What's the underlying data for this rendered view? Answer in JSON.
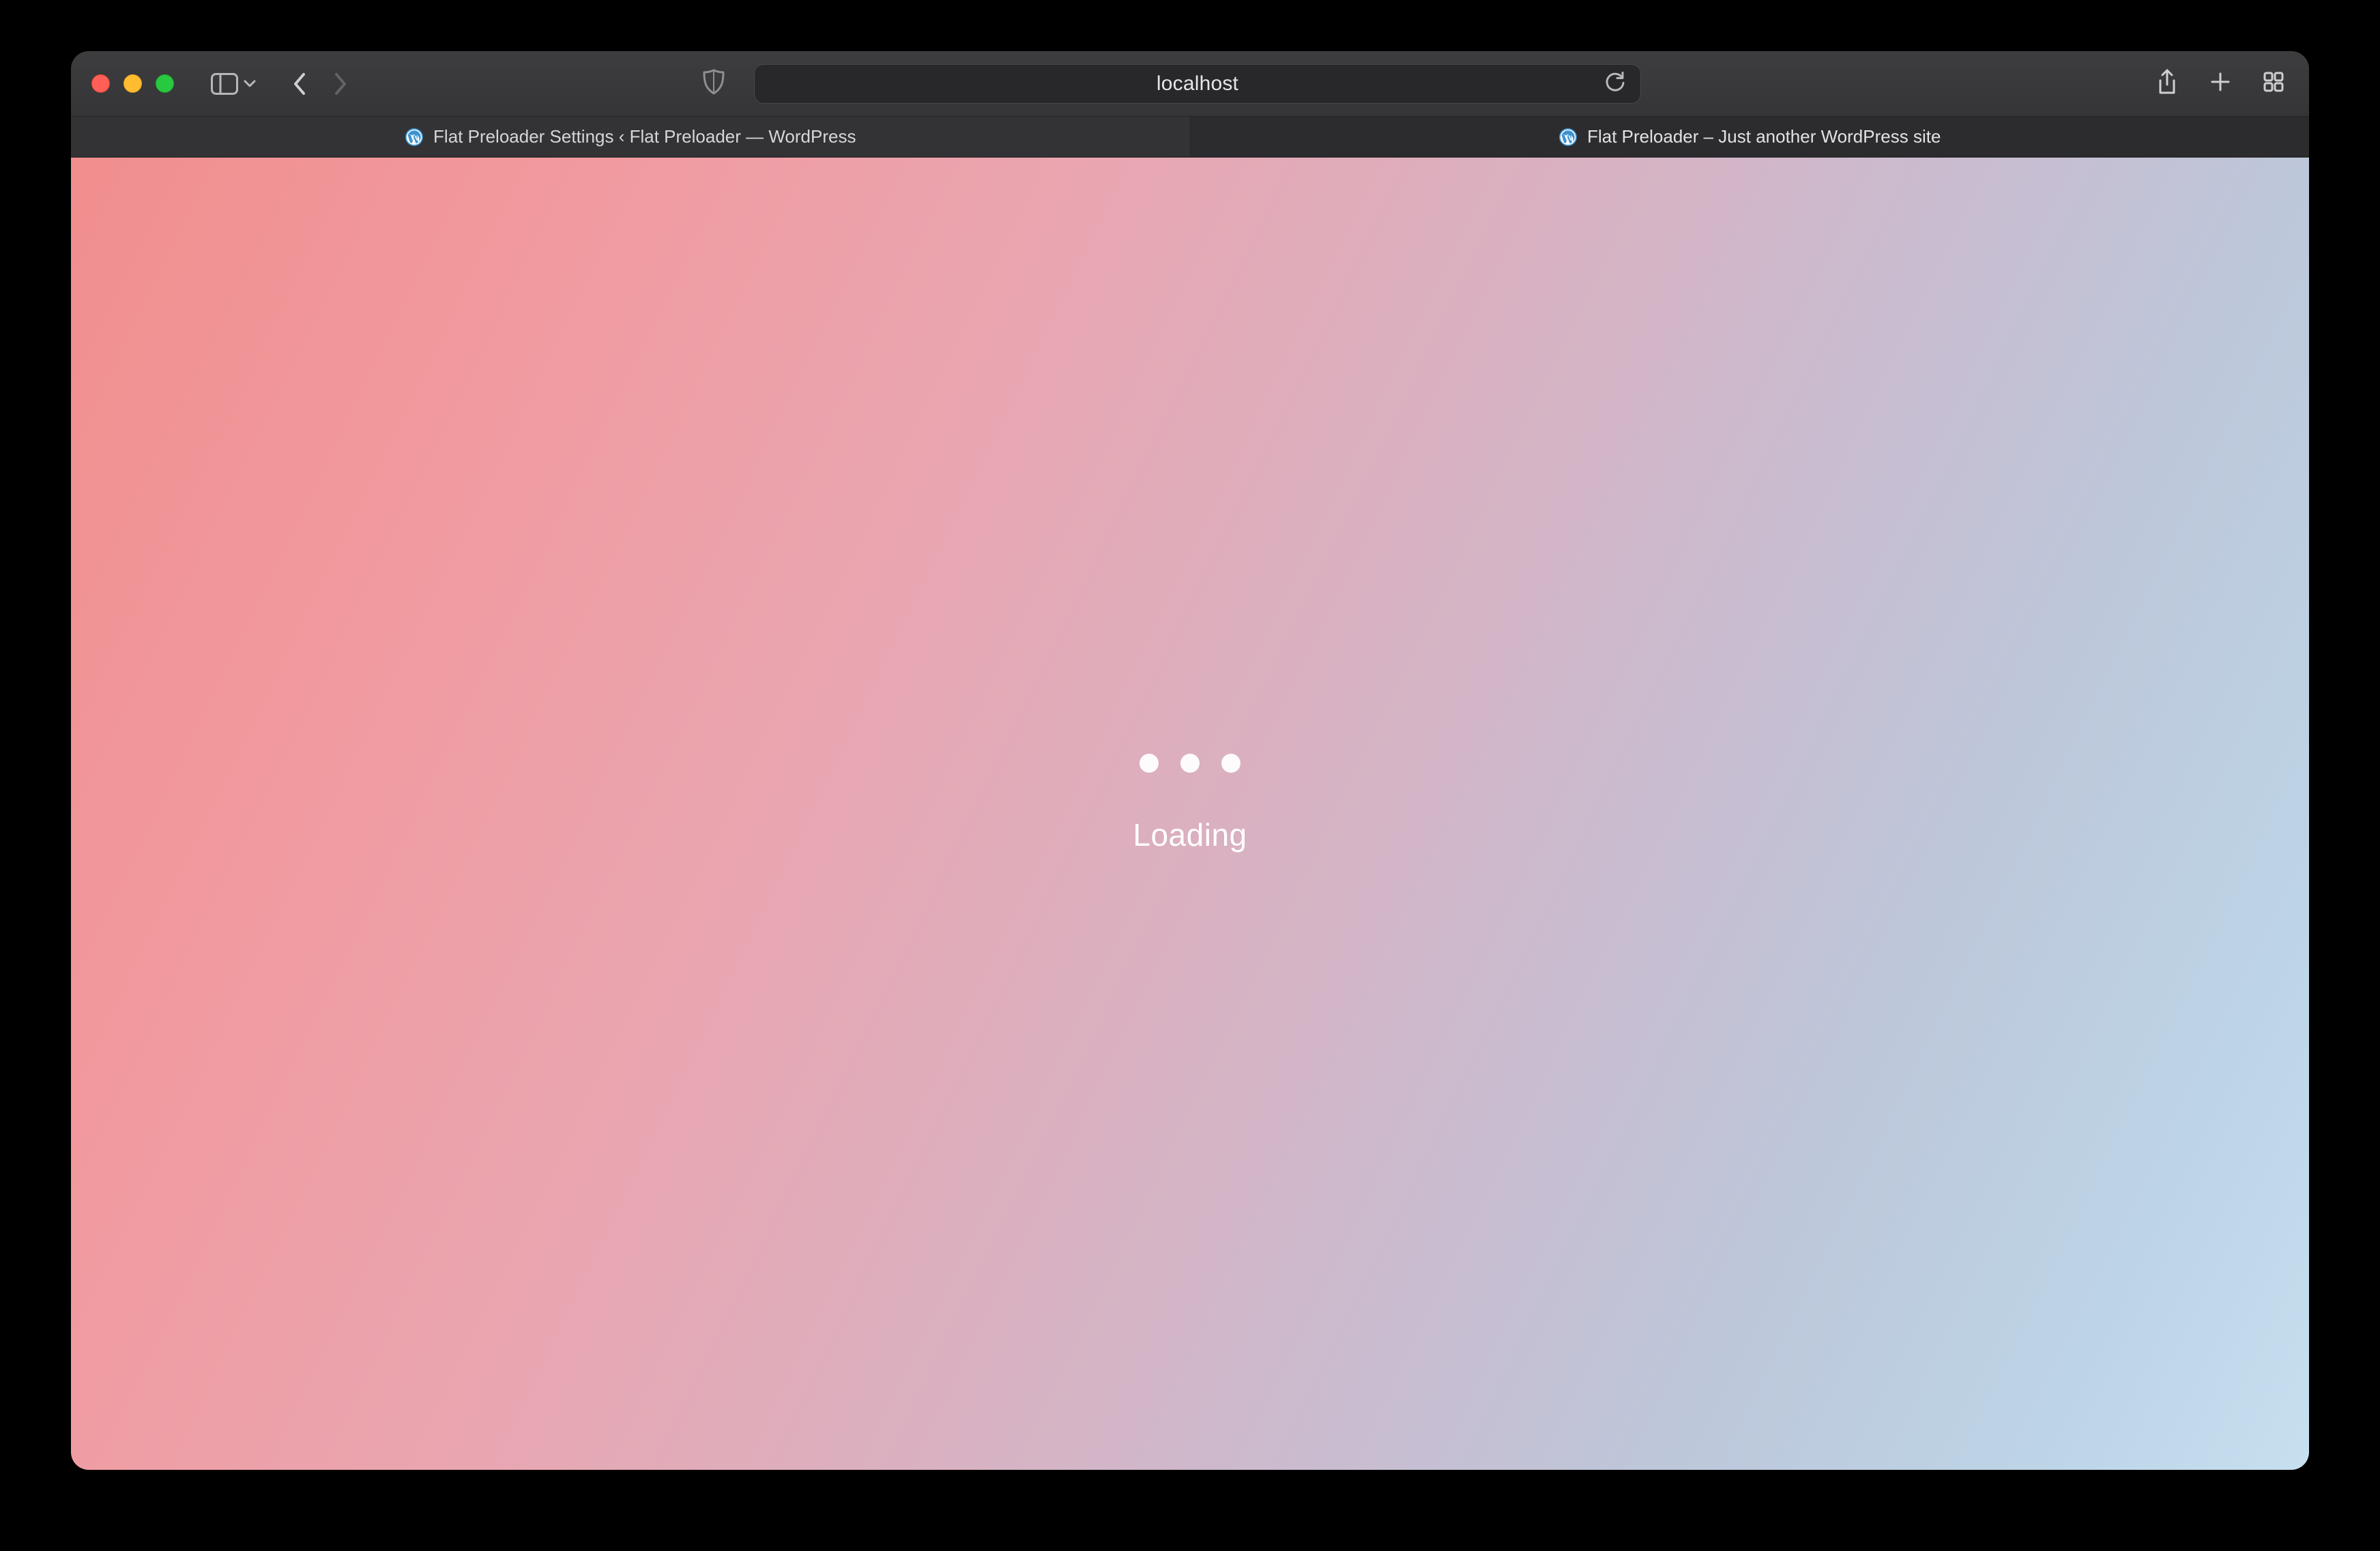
{
  "url_bar": {
    "host": "localhost"
  },
  "tabs": [
    {
      "title": "Flat Preloader Settings ‹ Flat Preloader — WordPress",
      "active": false,
      "icon": "wordpress"
    },
    {
      "title": "Flat Preloader – Just another WordPress site",
      "active": true,
      "icon": "wordpress"
    }
  ],
  "preloader": {
    "text": "Loading",
    "dots_count": 3,
    "bg_gradient": [
      "#f18e8e",
      "#c6e0f0"
    ],
    "text_color": "#ffffff"
  }
}
